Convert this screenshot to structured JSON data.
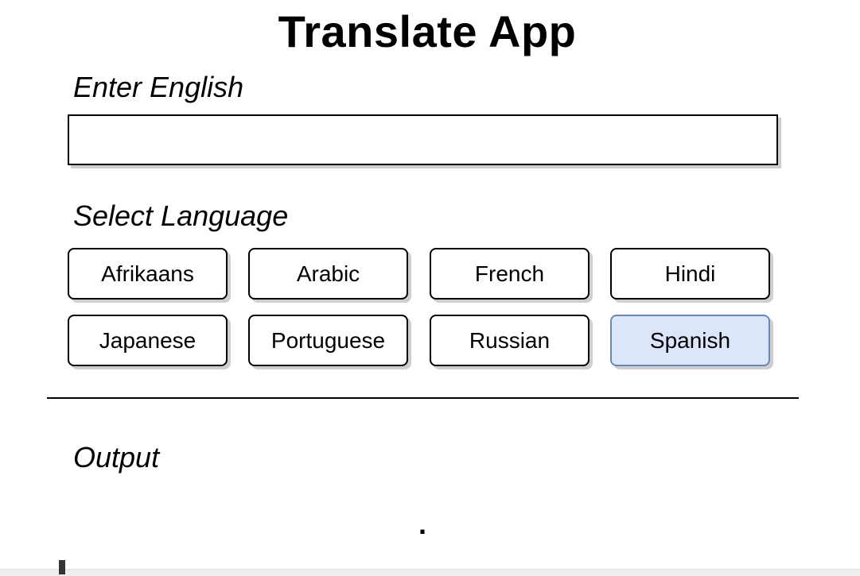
{
  "app": {
    "title": "Translate App"
  },
  "input_section": {
    "label": "Enter English",
    "value": "",
    "placeholder": ""
  },
  "language_section": {
    "label": "Select Language",
    "selected": "Spanish",
    "options": [
      "Afrikaans",
      "Arabic",
      "French",
      "Hindi",
      "Japanese",
      "Portuguese",
      "Russian",
      "Spanish"
    ]
  },
  "output_section": {
    "label": "Output",
    "value": "."
  },
  "colors": {
    "selected_background": "#dbe6fb",
    "selected_border": "#6a87b8"
  }
}
